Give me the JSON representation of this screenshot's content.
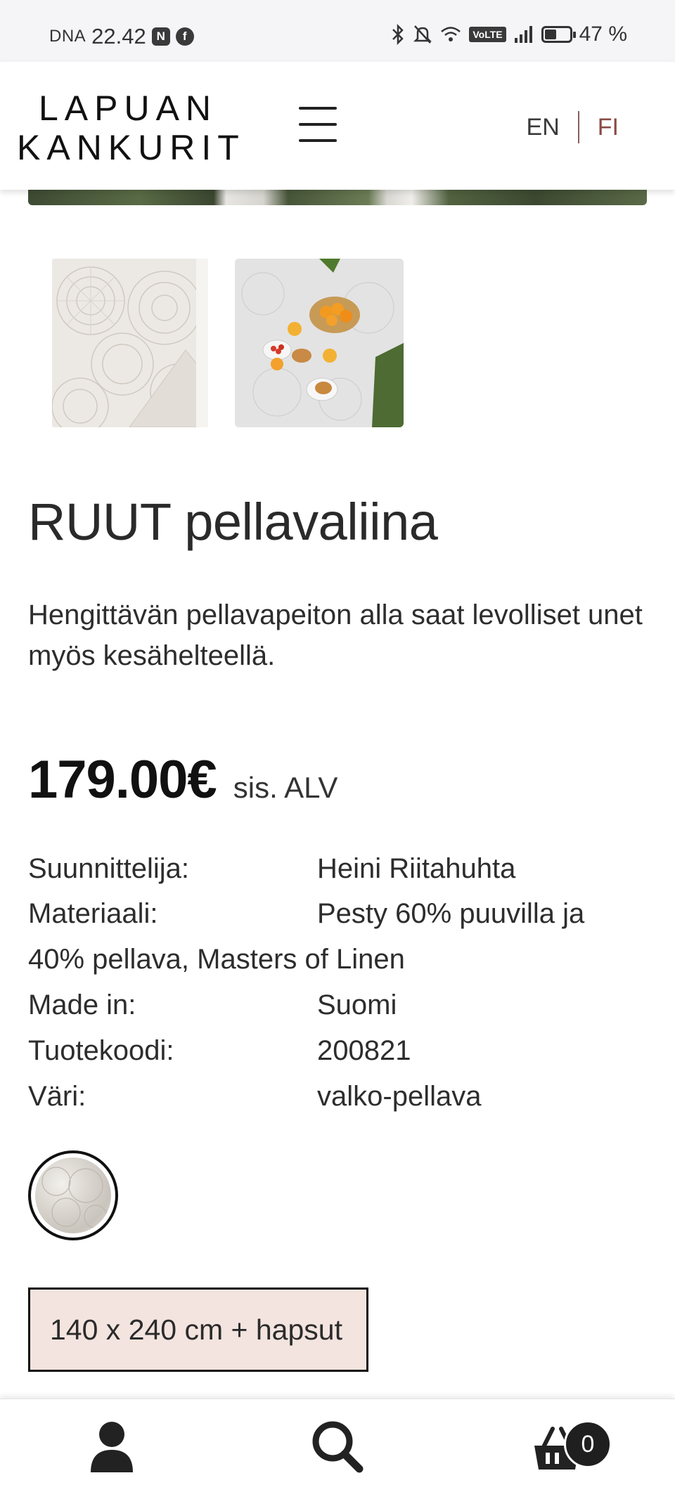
{
  "status_bar": {
    "carrier": "DNA",
    "time": "22.42",
    "battery": "47 %",
    "volte": "VoLTE"
  },
  "header": {
    "logo_line1": "LAPUAN",
    "logo_line2": "KANKURIT",
    "lang_en": "EN",
    "lang_fi": "FI",
    "accent_color": "#8a4a44"
  },
  "product": {
    "title": "RUUT pellavaliina",
    "description": "Hengittävän pellavapeiton alla saat levolliset unet myös kesähelteellä.",
    "price": "179.00€",
    "vat_label": "sis. ALV",
    "specs": {
      "designer_label": "Suunnittelija:",
      "designer_value": "Heini Riitahuhta",
      "material_label": "Materiaali:",
      "material_value_line1": "Pesty 60% puuvilla ja",
      "material_value_line2": "40% pellava, Masters of Linen",
      "made_in_label": "Made in:",
      "made_in_value": "Suomi",
      "code_label": "Tuotekoodi:",
      "code_value": "200821",
      "color_label": "Väri:",
      "color_value": "valko-pellava"
    },
    "size_option": "140 x 240 cm + hapsut"
  },
  "bottom_nav": {
    "cart_count": "0",
    "icons": [
      "user-icon",
      "search-icon",
      "cart-icon"
    ]
  }
}
